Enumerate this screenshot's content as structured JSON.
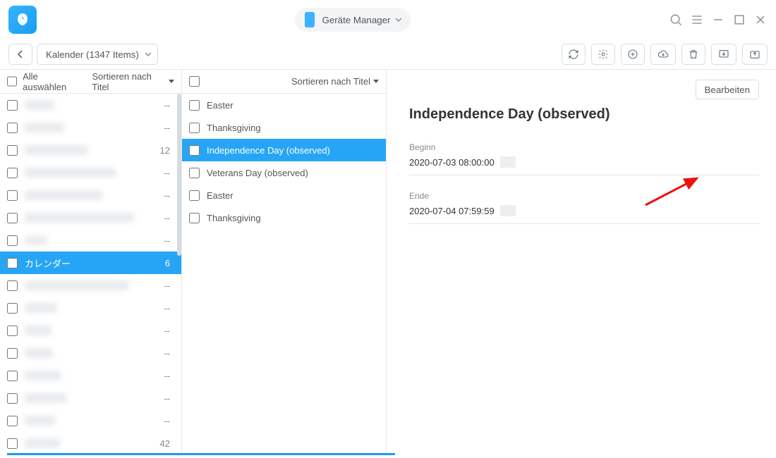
{
  "header": {
    "device_label": "Geräte Manager"
  },
  "toolbar": {
    "breadcrumb_label": "Kalender (1347 Items)"
  },
  "left_panel": {
    "select_all_label": "Alle auswählen",
    "sort_label": "Sortieren nach Titel",
    "items": [
      {
        "blur_w": 42,
        "count": "--",
        "selected": false
      },
      {
        "blur_w": 56,
        "count": "--",
        "selected": false
      },
      {
        "blur_w": 90,
        "count": "12",
        "selected": false
      },
      {
        "blur_w": 130,
        "count": "--",
        "selected": false
      },
      {
        "blur_w": 110,
        "count": "--",
        "selected": false
      },
      {
        "blur_w": 155,
        "count": "--",
        "selected": false
      },
      {
        "blur_w": 32,
        "count": "--",
        "selected": false
      },
      {
        "label": "カレンダー",
        "count": "6",
        "selected": true
      },
      {
        "blur_w": 148,
        "count": "--",
        "selected": false
      },
      {
        "blur_w": 46,
        "count": "--",
        "selected": false
      },
      {
        "blur_w": 38,
        "count": "--",
        "selected": false
      },
      {
        "blur_w": 40,
        "count": "--",
        "selected": false
      },
      {
        "blur_w": 52,
        "count": "--",
        "selected": false
      },
      {
        "blur_w": 60,
        "count": "--",
        "selected": false
      },
      {
        "blur_w": 44,
        "count": "--",
        "selected": false
      },
      {
        "blur_w": 50,
        "count": "42",
        "selected": false
      }
    ]
  },
  "mid_panel": {
    "sort_label": "Sortieren nach Titel",
    "items": [
      {
        "label": "Easter",
        "selected": false
      },
      {
        "label": "Thanksgiving",
        "selected": false
      },
      {
        "label": "Independence Day (observed)",
        "selected": true
      },
      {
        "label": "Veterans Day (observed)",
        "selected": false
      },
      {
        "label": "Easter",
        "selected": false
      },
      {
        "label": "Thanksgiving",
        "selected": false
      }
    ]
  },
  "detail": {
    "edit_label": "Bearbeiten",
    "title": "Independence Day (observed)",
    "fields": [
      {
        "label": "Beginn",
        "value": "2020-07-03 08:00:00"
      },
      {
        "label": "Ende",
        "value": "2020-07-04 07:59:59"
      }
    ]
  }
}
